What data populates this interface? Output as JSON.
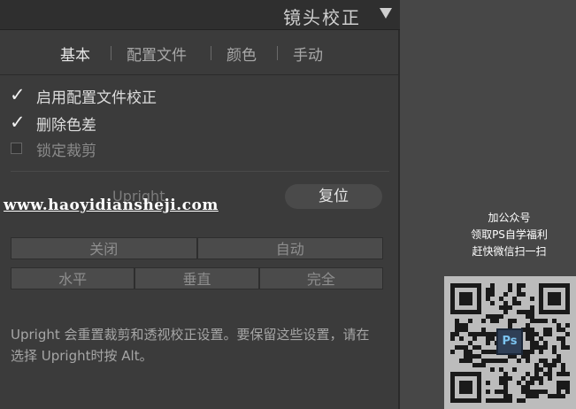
{
  "panel": {
    "title": "镜头校正",
    "tabs": [
      "基本",
      "配置文件",
      "颜色",
      "手动"
    ],
    "checkboxes": [
      {
        "label": "启用配置文件校正",
        "checked": true,
        "enabled": true
      },
      {
        "label": "删除色差",
        "checked": true,
        "enabled": true
      },
      {
        "label": "锁定裁剪",
        "checked": false,
        "enabled": false
      }
    ],
    "upright_label": "Upright",
    "reset_label": "复位",
    "mode_row_1": [
      "关闭",
      "自动"
    ],
    "mode_row_2": [
      "水平",
      "垂直",
      "完全"
    ],
    "description": "Upright 会重置裁剪和透视校正设置。要保留这些设置，请在选择 Upright时按 Alt。"
  },
  "watermark": {
    "text": "www.haoyidiansheji.com"
  },
  "promo": {
    "line1": "加公众号",
    "line2": "领取PS自学福利",
    "line3": "赶快微信扫一扫",
    "qr_logo": "Ps"
  },
  "colors": {
    "panel_bg": "#3b3b3b",
    "header_bg": "#2f2f2f",
    "outer_bg": "#474747"
  },
  "icons": {
    "collapse": "triangle-down-icon",
    "check": "check-icon"
  }
}
